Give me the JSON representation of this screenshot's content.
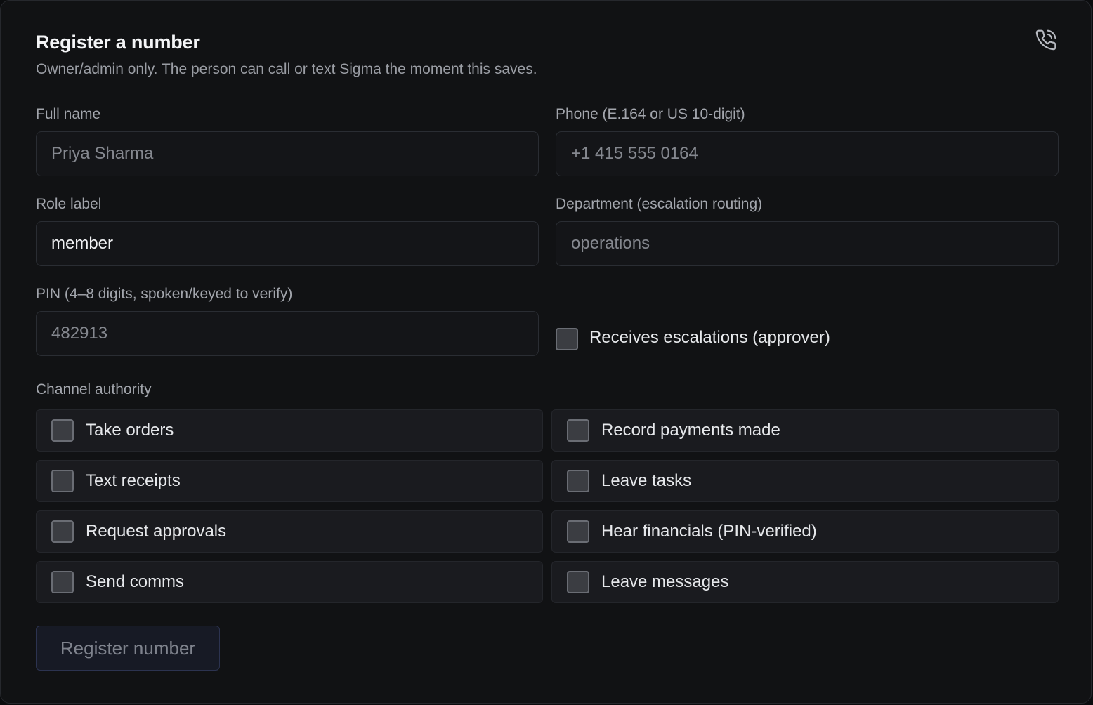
{
  "header": {
    "title": "Register a number",
    "subtitle": "Owner/admin only. The person can call or text Sigma the moment this saves.",
    "icon": "phone-call-icon"
  },
  "fields": {
    "full_name": {
      "label": "Full name",
      "value": "",
      "placeholder": "Priya Sharma"
    },
    "phone": {
      "label": "Phone (E.164 or US 10-digit)",
      "value": "",
      "placeholder": "+1 415 555 0164"
    },
    "role": {
      "label": "Role label",
      "value": "member",
      "placeholder": ""
    },
    "department": {
      "label": "Department (escalation routing)",
      "value": "",
      "placeholder": "operations"
    },
    "pin": {
      "label": "PIN (4–8 digits, spoken/keyed to verify)",
      "value": "",
      "placeholder": "482913"
    }
  },
  "escalations": {
    "label": "Receives escalations (approver)",
    "checked": false
  },
  "channel_authority": {
    "label": "Channel authority",
    "items": [
      {
        "label": "Take orders",
        "checked": false
      },
      {
        "label": "Record payments made",
        "checked": false
      },
      {
        "label": "Text receipts",
        "checked": false
      },
      {
        "label": "Leave tasks",
        "checked": false
      },
      {
        "label": "Request approvals",
        "checked": false
      },
      {
        "label": "Hear financials (PIN-verified)",
        "checked": false
      },
      {
        "label": "Send comms",
        "checked": false
      },
      {
        "label": "Leave messages",
        "checked": false
      }
    ]
  },
  "submit": {
    "label": "Register number"
  },
  "colors": {
    "background": "#111214",
    "input_background": "#141518",
    "tile_background": "#1a1b1f",
    "button_background": "#171a25",
    "text": "#e6e8eb",
    "muted": "#9a9da4"
  }
}
